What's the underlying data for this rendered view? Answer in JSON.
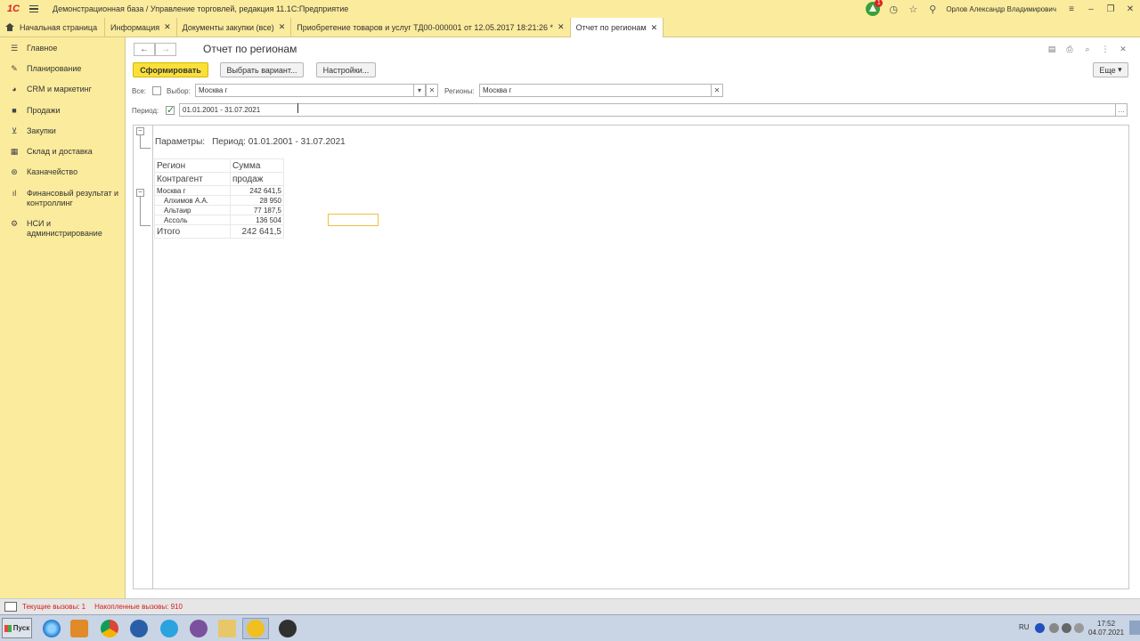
{
  "titlebar": {
    "logo_text": "1С",
    "title": "Демонстрационная база / Управление торговлей, редакция 11.1С:Предприятие",
    "notif_count": "1",
    "user": "Орлов Александр Владимирович"
  },
  "tabs": {
    "home": "Начальная страница",
    "items": [
      {
        "label": "Информация"
      },
      {
        "label": "Документы закупки (все)"
      },
      {
        "label": "Приобретение товаров и услуг ТД00-000001 от 12.05.2017 18:21:26 *"
      },
      {
        "label": "Отчет по регионам"
      }
    ]
  },
  "sidebar": {
    "items": [
      {
        "label": "Главное",
        "icon": "menu-icon"
      },
      {
        "label": "Планирование",
        "icon": "planning-icon"
      },
      {
        "label": "CRM и маркетинг",
        "icon": "crm-icon"
      },
      {
        "label": "Продажи",
        "icon": "sales-bag-icon"
      },
      {
        "label": "Закупки",
        "icon": "cart-icon"
      },
      {
        "label": "Склад и доставка",
        "icon": "warehouse-icon"
      },
      {
        "label": "Казначейство",
        "icon": "treasury-icon"
      },
      {
        "label": "Финансовый результат и контроллинг",
        "icon": "chart-icon"
      },
      {
        "label": "НСИ и администрирование",
        "icon": "gear-icon"
      }
    ]
  },
  "main": {
    "title": "Отчет по регионам",
    "buttons": {
      "generate": "Сформировать",
      "choose_variant": "Выбрать вариант...",
      "settings": "Настройки...",
      "more": "Еще"
    },
    "filters": {
      "all_label": "Все:",
      "selection_label": "Выбор:",
      "selection_value": "Москва г",
      "regions_label": "Регионы:",
      "regions_value": "Москва г",
      "period_label": "Период:",
      "period_value": "01.01.2001 - 31.07.2021",
      "period_checked": true
    }
  },
  "report": {
    "params_label": "Параметры:",
    "params_value": "Период: 01.01.2001 - 31.07.2021",
    "header": {
      "col1_row1": "Регион",
      "col1_row2": "Контрагент",
      "col2_row1": "Сумма",
      "col2_row2": "продаж"
    },
    "group": {
      "name": "Москва г",
      "value": "242 641,5"
    },
    "rows": [
      {
        "name": "Алхимов А.А.",
        "value": "28 950"
      },
      {
        "name": "Альтаир",
        "value": "77 187,5"
      },
      {
        "name": "Ассоль",
        "value": "136 504"
      }
    ],
    "total": {
      "name": "Итого",
      "value": "242 641,5"
    }
  },
  "statusbar": {
    "current_calls": "Текущие вызовы: 1",
    "accumulated_calls": "Накопленные вызовы: 910"
  },
  "taskbar": {
    "start": "Пуск",
    "lang": "RU",
    "time": "17:52",
    "date": "04.07.2021"
  }
}
